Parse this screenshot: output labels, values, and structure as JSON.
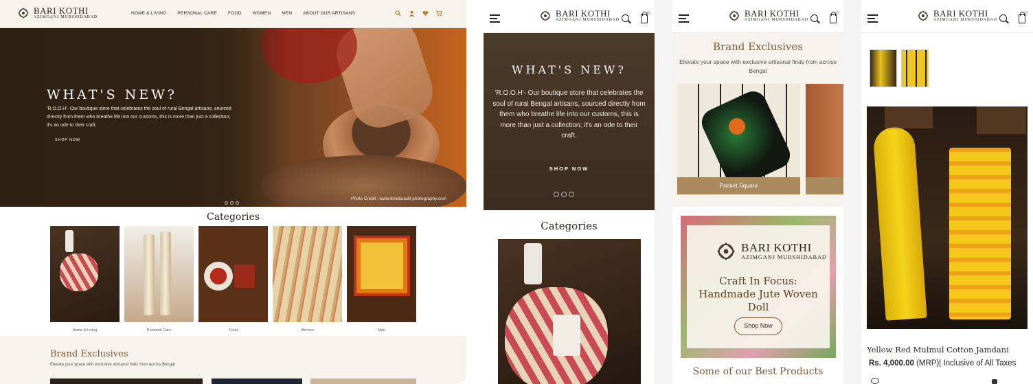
{
  "brand": {
    "name": "BARI KOTHI",
    "tagline": "AZIMGANJ MURSHIDABAD"
  },
  "desktop": {
    "nav": [
      "HOME & LIVING",
      "PERSONAL CARE",
      "FOOD",
      "WOMEN",
      "MEN",
      "ABOUT OUR ARTISANS"
    ],
    "icons": [
      "search-icon",
      "user-icon",
      "heart-icon",
      "cart-icon"
    ],
    "hero": {
      "title": "WHAT'S NEW?",
      "text": "'R.O.O.H'- Our boutique store that celebrates the soul of rural Bengal artisans, sourced directly from them who breathe life into our customs, this is more than just a collection; it's an ode to their craft.",
      "cta": "SHOP NOW",
      "credit": "Photo Credit : www.timebandit-photography.com"
    },
    "categories": {
      "title": "Categories",
      "items": [
        "Home & Living",
        "Personal Care",
        "Food",
        "Women",
        "Men"
      ]
    },
    "brand_exclusives": {
      "title": "Brand Exclusives",
      "subtitle": "Elevate your space with exclusive artisanal finds from across Bengal"
    }
  },
  "mobile1": {
    "cart_count": "0",
    "hero": {
      "title": "WHAT'S NEW?",
      "text": "'R.O.O.H'- Our boutique store that celebrates the soul of rural Bengal artisans, sourced directly from them who breathe life into our customs, this is more than just a collection; it's an ode to their craft.",
      "cta": "SHOP NOW"
    },
    "categories_title": "Categories"
  },
  "mobile2": {
    "cart_count": "0",
    "brand_exclusives": {
      "title": "Brand Exclusives",
      "subtitle": "Elevate your space with exclusive artisanal finds from across Bengal",
      "product_label": "Pocket Square"
    },
    "focus": {
      "title": "Craft In Focus: Handmade Jute Woven Doll",
      "cta": "Shop Now"
    },
    "best_products_title": "Some of our Best Products"
  },
  "mobile3": {
    "cart_count": "0",
    "product": {
      "name": "Yellow Red Mulmul Cotton Jamdani",
      "price": "Rs. 4,000.00",
      "price_note": "(MRP)| Inclusive of All Taxes"
    }
  },
  "colors": {
    "accent": "#7a5a3a",
    "cream": "#f6f3ec",
    "hero_dark": "#3a2a17",
    "label_band": "#a98a5c"
  }
}
